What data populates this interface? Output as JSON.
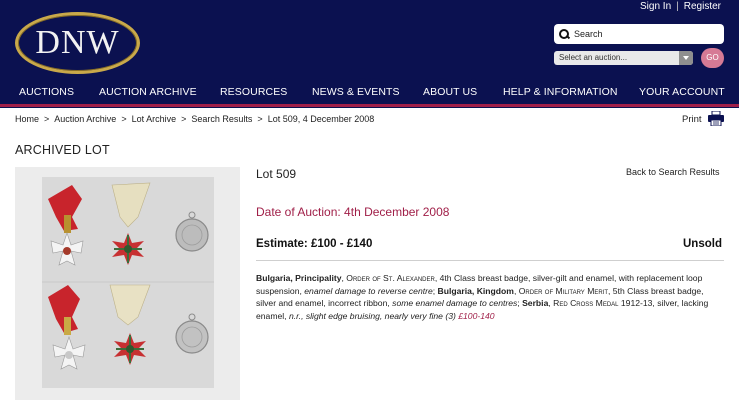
{
  "header": {
    "logo_text": "DNW",
    "sign_in": "Sign In",
    "separator": "|",
    "register": "Register",
    "search_placeholder": "Search",
    "auction_select": "Select an auction...",
    "go": "GO"
  },
  "nav": {
    "items": [
      "AUCTIONS",
      "AUCTION ARCHIVE",
      "RESOURCES",
      "NEWS & EVENTS",
      "ABOUT US",
      "HELP & INFORMATION",
      "YOUR ACCOUNT"
    ]
  },
  "breadcrumb": {
    "items": [
      "Home",
      "Auction Archive",
      "Lot Archive",
      "Search Results",
      "Lot 509, 4 December 2008"
    ],
    "separator": ">"
  },
  "print_label": "Print",
  "page_title": "ARCHIVED LOT",
  "lot": {
    "number": "Lot 509",
    "back_link": "Back to Search Results",
    "date": "Date of Auction: 4th December 2008",
    "estimate": "Estimate: £100 - £140",
    "status": "Unsold",
    "description": {
      "p1_bold": "Bulgaria, Principality",
      "p1_sc": "Order of St. Alexander",
      "p1_text": ", 4th Class breast badge, silver-gilt and enamel, with replacement loop suspension, ",
      "p1_italic": "enamel damage to reverse centre",
      "p2_bold": "Bulgaria, Kingdom",
      "p2_sc": "Order of Military Merit",
      "p2_text": ", 5th Class breast badge, silver and enamel, incorrect ribbon, ",
      "p2_italic": "some enamel damage to centres",
      "p3_bold": "Serbia",
      "p3_sc": "Red Cross Medal",
      "p3_text": " 1912-13, silver, lacking enamel, ",
      "p3_italic": "n.r., slight edge bruising, nearly very fine (3)",
      "estimate_inline": "£100-140"
    }
  },
  "colors": {
    "header_bg": "#0b1150",
    "accent": "#a01f48",
    "logo_ring": "#c9a94a"
  }
}
